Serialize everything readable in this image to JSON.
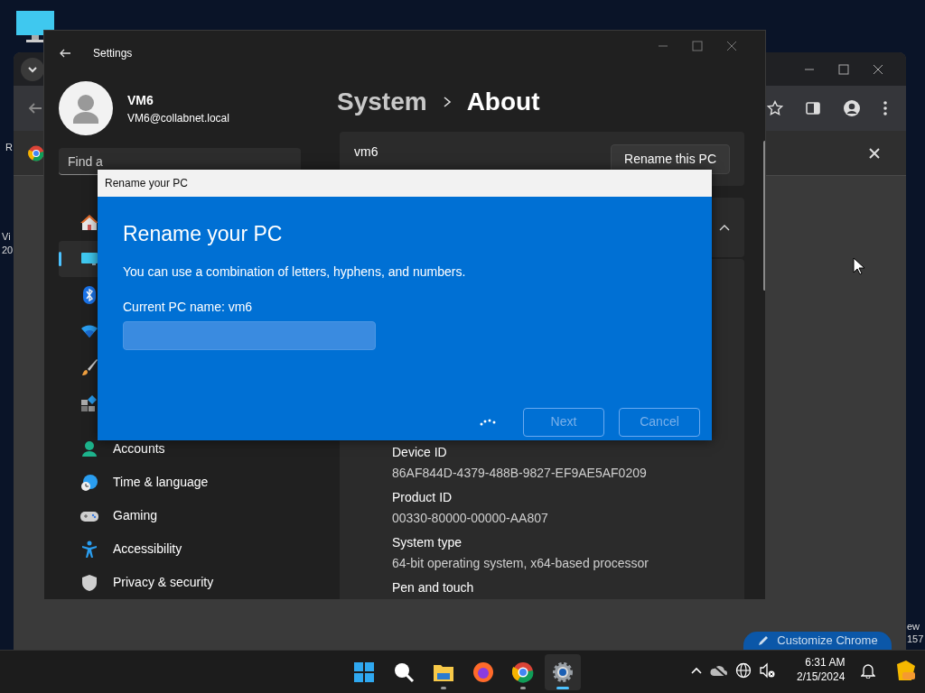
{
  "desktop": {
    "left_fragments": [
      "R",
      "Vi",
      "20"
    ],
    "right_fragments": [
      "ew",
      "157"
    ]
  },
  "browser": {
    "customize_button": "Customize Chrome"
  },
  "settings": {
    "title": "Settings",
    "user": {
      "name": "VM6",
      "email": "VM6@collabnet.local"
    },
    "search": {
      "placeholder": "Find a"
    },
    "breadcrumb": [
      "System",
      "About"
    ],
    "device": {
      "name": "vm6",
      "rename_button": "Rename this PC"
    },
    "nav": [
      {
        "selected": false
      },
      {
        "selected": true
      },
      {
        "selected": false
      },
      {
        "selected": false
      },
      {
        "selected": false
      },
      {
        "selected": false
      },
      {
        "label": "Accounts",
        "selected": false
      },
      {
        "label": "Time & language",
        "selected": false
      },
      {
        "label": "Gaming",
        "selected": false
      },
      {
        "label": "Accessibility",
        "selected": false
      },
      {
        "label": "Privacy & security",
        "selected": false
      }
    ],
    "specs": [
      {
        "label": "Device ID",
        "value": "86AF844D-4379-488B-9827-EF9AE5AF0209"
      },
      {
        "label": "Product ID",
        "value": "00330-80000-00000-AA807"
      },
      {
        "label": "System type",
        "value": "64-bit operating system, x64-based processor"
      },
      {
        "label": "Pen and touch"
      }
    ]
  },
  "dialog": {
    "title": "Rename your PC",
    "heading": "Rename your PC",
    "description": "You can use a combination of letters, hyphens, and numbers.",
    "current_name": "Current PC name: vm6",
    "busy": true,
    "buttons": [
      {
        "label": "Next",
        "disabled": true
      },
      {
        "label": "Cancel",
        "disabled": true
      }
    ]
  },
  "taskbar": {
    "apps": [
      {
        "running": false,
        "selected": false
      },
      {
        "running": false,
        "selected": false
      },
      {
        "running": true,
        "selected": false
      },
      {
        "running": false,
        "selected": false
      },
      {
        "running": true,
        "selected": false
      },
      {
        "running": true,
        "selected": true
      }
    ],
    "time": "6:31 AM",
    "date": "2/15/2024"
  }
}
